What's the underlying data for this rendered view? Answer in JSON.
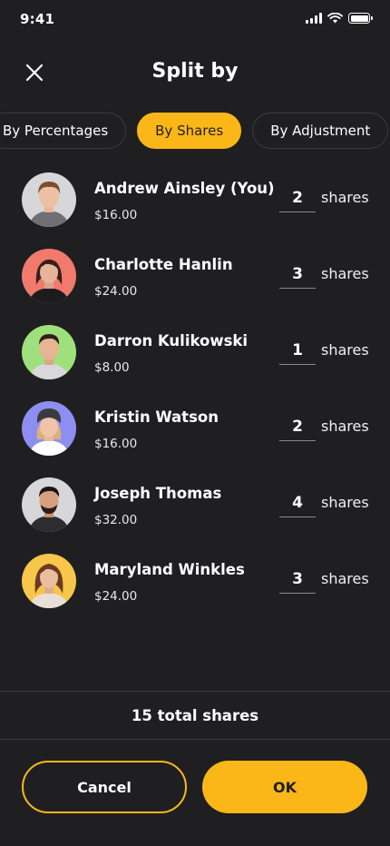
{
  "status": {
    "time": "9:41"
  },
  "header": {
    "title": "Split by"
  },
  "tabs": [
    {
      "label": "By Percentages",
      "active": false
    },
    {
      "label": "By Shares",
      "active": true
    },
    {
      "label": "By Adjustment",
      "active": false
    }
  ],
  "shares_unit": "shares",
  "people": [
    {
      "name": "Andrew Ainsley (You)",
      "amount": "$16.00",
      "shares": "2",
      "avatar_bg": "#d7d7da"
    },
    {
      "name": "Charlotte Hanlin",
      "amount": "$24.00",
      "shares": "3",
      "avatar_bg": "#f27a6c"
    },
    {
      "name": "Darron Kulikowski",
      "amount": "$8.00",
      "shares": "1",
      "avatar_bg": "#9fe07c"
    },
    {
      "name": "Kristin Watson",
      "amount": "$16.00",
      "shares": "2",
      "avatar_bg": "#8e8ef2"
    },
    {
      "name": "Joseph Thomas",
      "amount": "$32.00",
      "shares": "4",
      "avatar_bg": "#d7d7da"
    },
    {
      "name": "Maryland Winkles",
      "amount": "$24.00",
      "shares": "3",
      "avatar_bg": "#f8c64a"
    }
  ],
  "total": "15 total shares",
  "buttons": {
    "cancel": "Cancel",
    "ok": "OK"
  },
  "colors": {
    "accent": "#fbb718",
    "background": "#1f1f22"
  }
}
